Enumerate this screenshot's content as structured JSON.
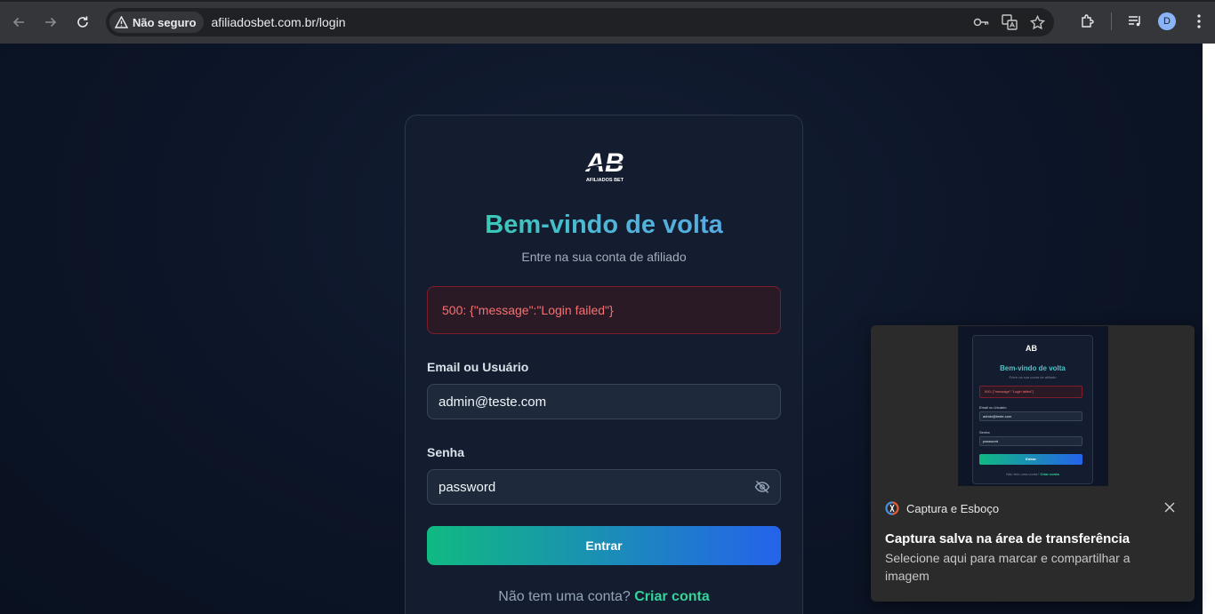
{
  "browser": {
    "security_label": "Não seguro",
    "url": "afiliadosbet.com.br/login",
    "profile_initial": "D"
  },
  "login": {
    "logo_text": "AB",
    "logo_caption": "AFILIADOS BET",
    "title": "Bem-vindo de volta",
    "subtitle": "Entre na sua conta de afiliado",
    "error": "500: {\"message\":\"Login failed\"}",
    "email_label": "Email ou Usuário",
    "email_value": "admin@teste.com",
    "password_label": "Senha",
    "password_value": "password",
    "submit_label": "Entrar",
    "footer_text": "Não tem uma conta?",
    "footer_link": "Criar conta"
  },
  "toast": {
    "app_name": "Captura e Esboço",
    "heading": "Captura salva na área de transferência",
    "body": "Selecione aqui para marcar e compartilhar a imagem"
  },
  "colors": {
    "page_bg": "#0f172a",
    "card_bg": "#141d2f",
    "accent_green": "#10b981",
    "accent_blue": "#2563eb",
    "error_text": "#f87171",
    "link": "#34d399"
  },
  "icons": [
    "back-icon",
    "forward-icon",
    "reload-icon",
    "warning-icon",
    "key-icon",
    "translate-icon",
    "star-icon",
    "extensions-icon",
    "media-icon",
    "menu-icon",
    "eye-off-icon",
    "close-icon",
    "snip-icon"
  ]
}
